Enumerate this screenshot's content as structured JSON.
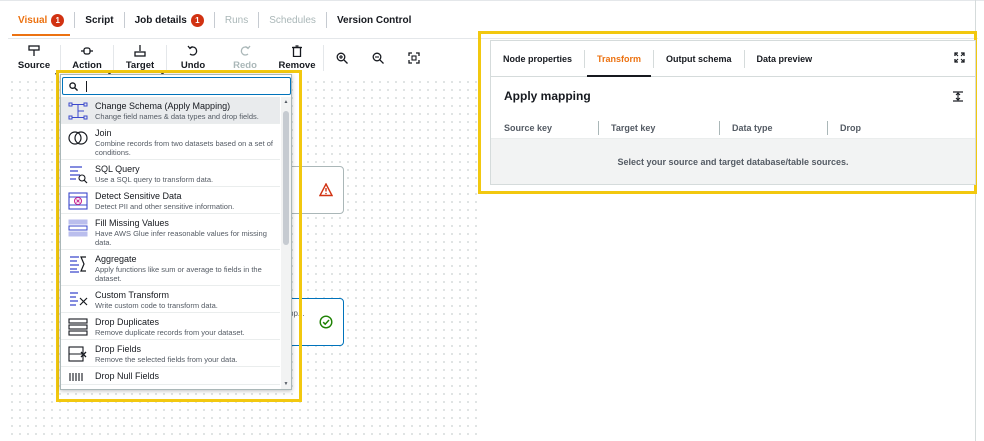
{
  "tabs": [
    {
      "label": "Visual",
      "badge": "1"
    },
    {
      "label": "Script"
    },
    {
      "label": "Job details",
      "badge": "1"
    },
    {
      "label": "Runs"
    },
    {
      "label": "Schedules"
    },
    {
      "label": "Version Control"
    }
  ],
  "toolbar": {
    "source": "Source",
    "action": "Action",
    "target": "Target",
    "undo": "Undo",
    "redo": "Redo",
    "remove": "Remove"
  },
  "search": {
    "value": "",
    "placeholder": ""
  },
  "transforms": [
    {
      "title": "Change Schema (Apply Mapping)",
      "desc": "Change field names & data types and drop fields."
    },
    {
      "title": "Join",
      "desc": "Combine records from two datasets based on a set of conditions."
    },
    {
      "title": "SQL Query",
      "desc": "Use a SQL query to transform data."
    },
    {
      "title": "Detect Sensitive Data",
      "desc": "Detect PII and other sensitive information."
    },
    {
      "title": "Fill Missing Values",
      "desc": "Have AWS Glue infer reasonable values for missing data."
    },
    {
      "title": "Aggregate",
      "desc": "Apply functions like sum or average to fields in the dataset."
    },
    {
      "title": "Custom Transform",
      "desc": "Write custom code to transform data."
    },
    {
      "title": "Drop Duplicates",
      "desc": "Remove duplicate records from your dataset."
    },
    {
      "title": "Drop Fields",
      "desc": "Remove the selected fields from your data."
    },
    {
      "title": "Drop Null Fields",
      "desc": ""
    }
  ],
  "canvas": {
    "node2_label": "pp..."
  },
  "panel": {
    "tabs": [
      "Node properties",
      "Transform",
      "Output schema",
      "Data preview"
    ],
    "title": "Apply mapping",
    "columns": [
      "Source key",
      "Target key",
      "Data type",
      "Drop"
    ],
    "empty_message": "Select your source and target database/table sources."
  },
  "colors": {
    "accent": "#ec7211",
    "highlight": "#f2c80f",
    "badge": "#d13212",
    "link": "#0073bb"
  }
}
